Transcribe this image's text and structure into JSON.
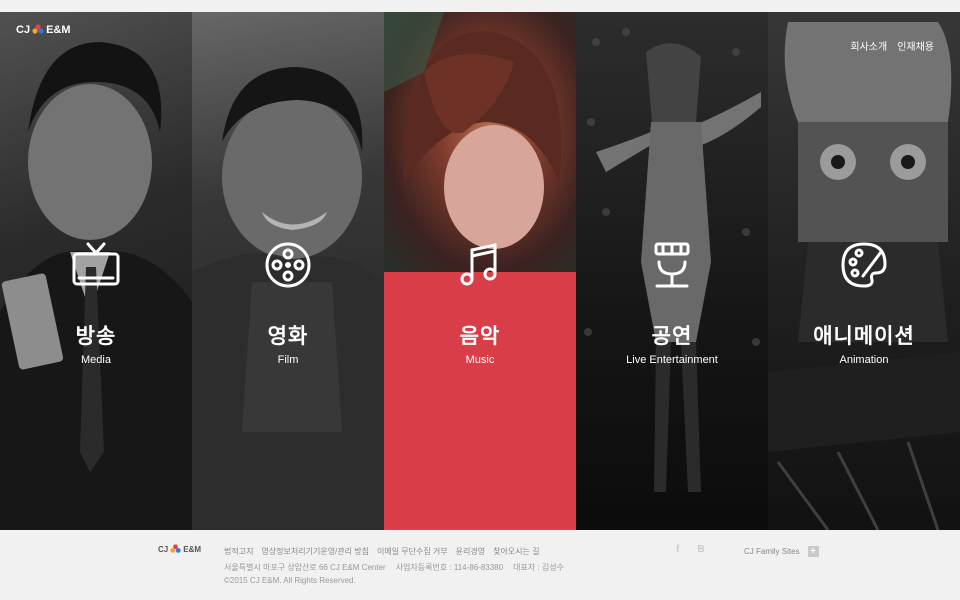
{
  "brand": {
    "logo_left": "CJ",
    "logo_right": "E&M"
  },
  "topnav": [
    {
      "label": "회사소개"
    },
    {
      "label": "인재채용"
    }
  ],
  "panels": [
    {
      "kor": "방송",
      "eng": "Media",
      "icon": "tv-icon"
    },
    {
      "kor": "영화",
      "eng": "Film",
      "icon": "film-reel-icon"
    },
    {
      "kor": "음악",
      "eng": "Music",
      "icon": "music-note-icon"
    },
    {
      "kor": "공연",
      "eng": "Live Entertainment",
      "icon": "microphone-stand-icon"
    },
    {
      "kor": "애니메이션",
      "eng": "Animation",
      "icon": "palette-icon"
    }
  ],
  "footer": {
    "logo_left": "CJ",
    "logo_right": "E&M",
    "links": [
      "법적고지",
      "영상정보처리기기운영/관리 방침",
      "이메일 무단수집 거부",
      "윤리경영",
      "찾아오시는 길"
    ],
    "address": "서울특별시 마포구 상암산로 66 CJ E&M Center",
    "business_no": "사업자등록번호 : 114-86-83380",
    "ceo": "대표자 : 김성수",
    "copyright": "©2015 CJ E&M. All Rights Reserved.",
    "social": [
      "f",
      "B"
    ],
    "family_label": "CJ Family Sites",
    "family_plus": "+"
  },
  "colors": {
    "accent_red": "#e8404b",
    "footer_bg": "#f1f1f1"
  }
}
